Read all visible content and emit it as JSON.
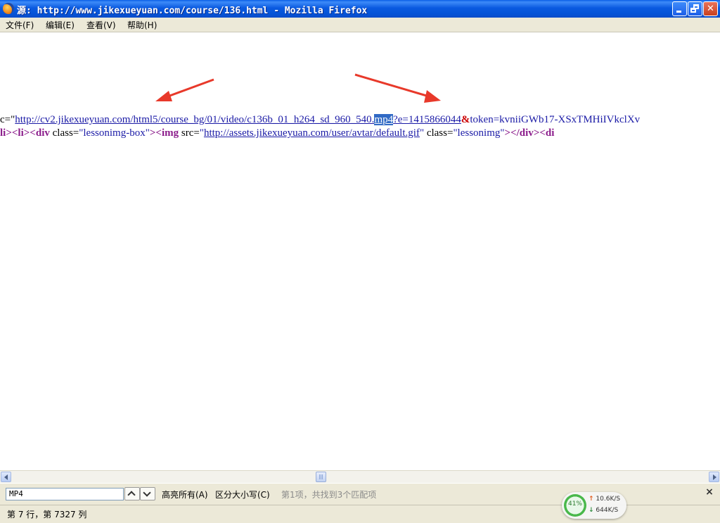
{
  "window": {
    "title": "源: http://www.jikexueyuan.com/course/136.html - Mozilla Firefox",
    "buttons": {
      "minimize": "_",
      "maximize": "□",
      "close": "✕"
    }
  },
  "menu": {
    "items": [
      "文件(F)",
      "编辑(E)",
      "查看(V)",
      "帮助(H)"
    ]
  },
  "source": {
    "line1": {
      "prefix": "c=",
      "quote": "\"",
      "url_before": "http://cv2.jikexueyuan.com/html5/course_bg/01/video/c136b_01_h264_sd_960_540.",
      "url_highlight": "mp4",
      "url_after": "?e=1415866044",
      "entity": "&",
      "tail": "token=kvniiGWb17-XSxTMHiIVkclXv"
    },
    "line2": {
      "t1": "li><li><",
      "t2": "div",
      "t3": " class=",
      "t4": "\"lessonimg-box\"",
      "t5": "><",
      "t6": "img",
      "t7": " src=",
      "t8": "\"",
      "t9": "http://assets.jikexueyuan.com/user/avtar/default.gif",
      "t10": "\"",
      "t11": " class=",
      "t12": "\"lessonimg\"",
      "t13": "></",
      "t14": "div",
      "t15": "><",
      "t16": "di"
    },
    "arrow_color": "#e8392a"
  },
  "findbar": {
    "search_value": "MP4",
    "highlight_all": "高亮所有(A)",
    "match_case": "区分大小写(C)",
    "status": "第1项，共找到3个匹配项",
    "close": "×"
  },
  "statusbar": {
    "position": "第 7 行，第 7327 列"
  },
  "network": {
    "percent": "41%",
    "upload": "10.6K/S",
    "download": "644K/S"
  }
}
